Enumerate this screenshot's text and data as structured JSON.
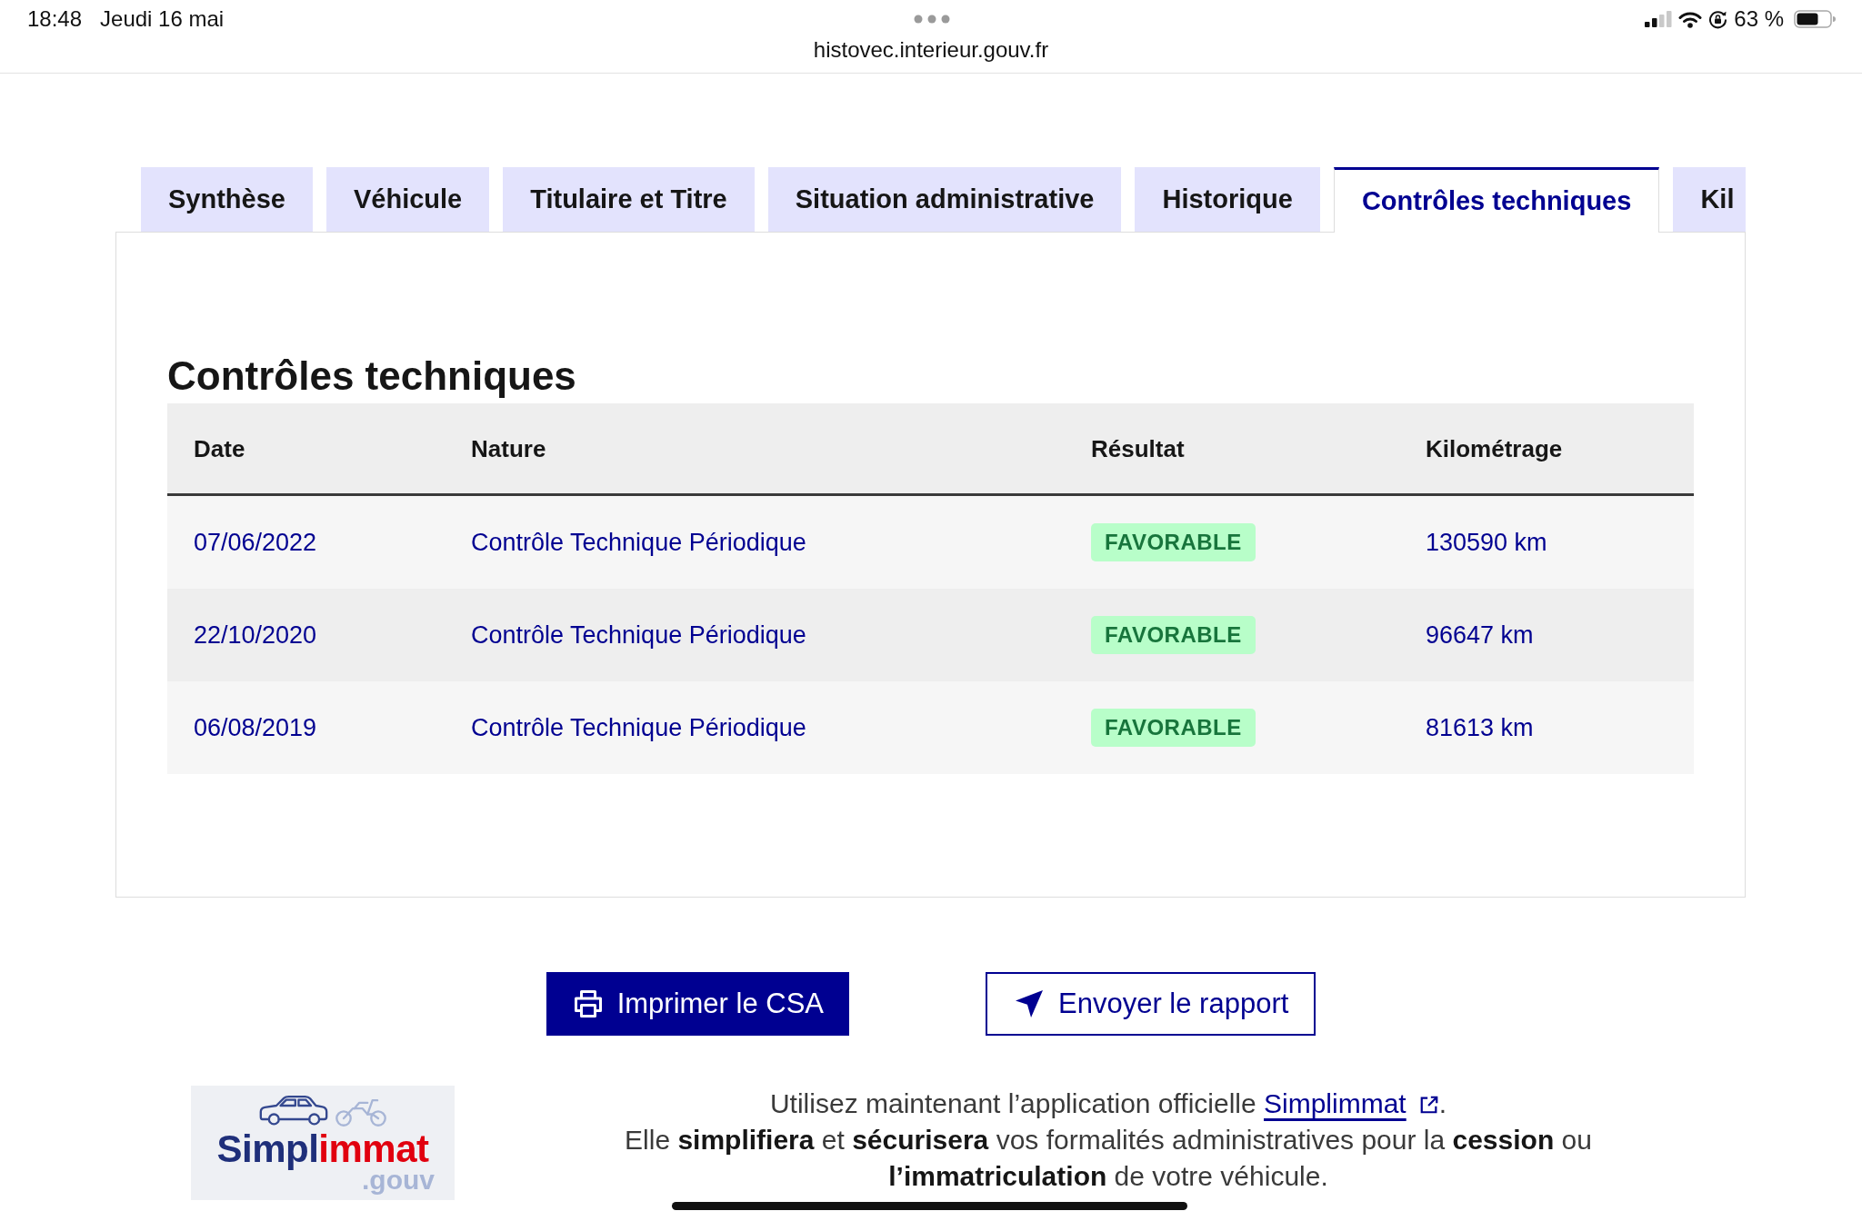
{
  "status_bar": {
    "time": "18:48",
    "date": "Jeudi 16 mai",
    "url": "histovec.interieur.gouv.fr",
    "battery": "63 %"
  },
  "tabs": [
    {
      "label": "Synthèse",
      "selected": false
    },
    {
      "label": "Véhicule",
      "selected": false
    },
    {
      "label": "Titulaire et Titre",
      "selected": false
    },
    {
      "label": "Situation administrative",
      "selected": false
    },
    {
      "label": "Historique",
      "selected": false
    },
    {
      "label": "Contrôles techniques",
      "selected": true
    },
    {
      "label": "Kil",
      "selected": false
    }
  ],
  "section": {
    "title": "Contrôles techniques",
    "table": {
      "columns": [
        "Date",
        "Nature",
        "Résultat",
        "Kilométrage"
      ],
      "rows": [
        {
          "date": "07/06/2022",
          "nature": "Contrôle Technique Périodique",
          "result": "FAVORABLE",
          "mileage": "130590 km"
        },
        {
          "date": "22/10/2020",
          "nature": "Contrôle Technique Périodique",
          "result": "FAVORABLE",
          "mileage": "96647 km"
        },
        {
          "date": "06/08/2019",
          "nature": "Contrôle Technique Périodique",
          "result": "FAVORABLE",
          "mileage": "81613 km"
        }
      ]
    }
  },
  "actions": [
    {
      "kind": "print",
      "label": "Imprimer le CSA"
    },
    {
      "kind": "send",
      "label": "Envoyer le rapport"
    }
  ],
  "footer": {
    "logo": {
      "name_start": "Simpl",
      "name_end": "immat",
      "suffix": ".gouv"
    },
    "intro": "Utilisez maintenant l’application officielle",
    "link": "Simplimmat",
    "intro_end": ".",
    "note": "Elle **simplifiera** et **sécurisera** vos formalités administratives pour la **cession** ou **l’immatriculation** de votre véhicule."
  }
}
